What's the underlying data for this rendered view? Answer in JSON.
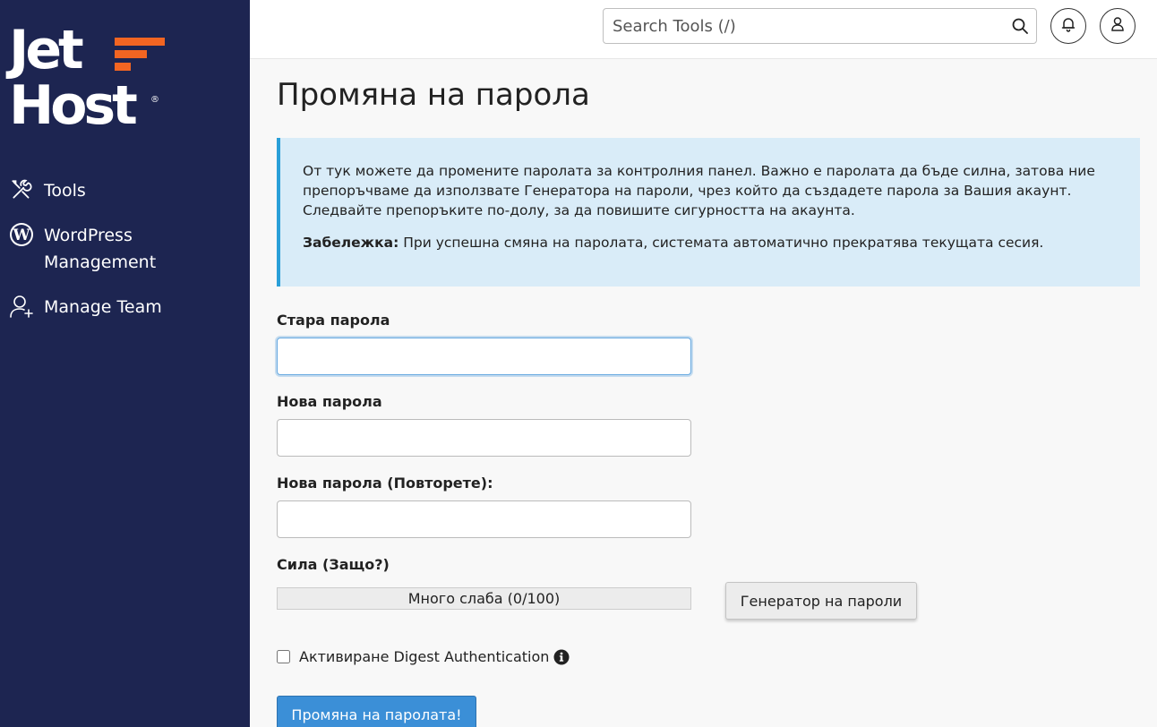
{
  "brand": {
    "line1": "Jet",
    "line2": "Host",
    "registered": "®",
    "accent_color": "#f26522",
    "sidebar_color": "#1d2551"
  },
  "sidebar": {
    "items": [
      {
        "label": "Tools",
        "icon": "tools-icon"
      },
      {
        "label": "WordPress Management",
        "line1": "WordPress",
        "line2": "Management",
        "icon": "wordpress-icon"
      },
      {
        "label": "Manage Team",
        "icon": "manage-team-icon"
      }
    ]
  },
  "header": {
    "search_placeholder": "Search Tools (/)",
    "icons": [
      "search-icon",
      "bell-icon",
      "user-icon"
    ]
  },
  "page": {
    "title": "Промяна на парола",
    "alert_text": "От тук можете да промените паролата за контролния панел. Важно е паролата да бъде силна, затова ние препоръчваме да използвате Генератора на пароли, чрез който да създадете парола за Вашия акаунт. Следвайте препоръките по-долу, за да повишите сигурността на акаунта.",
    "note_label": "Забележка:",
    "note_text": " При успешна смяна на паролата, системата автоматично прекратява текущата сесия."
  },
  "form": {
    "old_password_label": "Стара парола",
    "old_password_value": "",
    "new_password_label": "Нова парола",
    "new_password_value": "",
    "repeat_password_label": "Нова парола (Повторете):",
    "repeat_password_value": "",
    "strength_label": "Сила (Защо?)",
    "strength_text": "Много слаба (0/100)",
    "strength_value": 0,
    "generator_button": "Генератор на пароли",
    "digest_label": "Активиране Digest Authentication",
    "digest_checked": false,
    "submit_button": "Промяна на паролата!",
    "submit_color": "#3b8fd7"
  }
}
